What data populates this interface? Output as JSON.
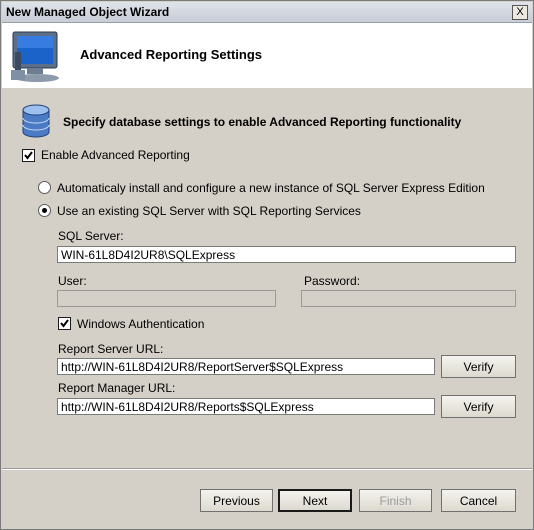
{
  "window": {
    "title": "New Managed Object Wizard",
    "close_glyph": "X"
  },
  "header": {
    "title": "Advanced Reporting Settings",
    "icon": "monitor-icon"
  },
  "section": {
    "text": "Specify database settings to enable Advanced Reporting functionality",
    "icon": "database-icon"
  },
  "enable_reporting": {
    "label": "Enable Advanced Reporting",
    "checked": true
  },
  "options": {
    "auto_install": {
      "label": "Automaticaly install and configure a new instance of SQL Server Express Edition",
      "selected": false
    },
    "existing_server": {
      "label": "Use an existing SQL Server with SQL Reporting Services",
      "selected": true
    }
  },
  "fields": {
    "sql_server": {
      "label": "SQL Server:",
      "value": "WIN-61L8D4I2UR8\\SQLExpress"
    },
    "user": {
      "label": "User:",
      "value": ""
    },
    "password": {
      "label": "Password:",
      "value": ""
    },
    "windows_auth": {
      "label": "Windows Authentication",
      "checked": true
    },
    "report_server_url": {
      "label": "Report Server URL:",
      "value": "http://WIN-61L8D4I2UR8/ReportServer$SQLExpress"
    },
    "report_manager_url": {
      "label": "Report Manager URL:",
      "value": "http://WIN-61L8D4I2UR8/Reports$SQLExpress"
    }
  },
  "buttons": {
    "verify": "Verify",
    "previous": "Previous",
    "next": "Next",
    "finish": "Finish",
    "cancel": "Cancel"
  }
}
